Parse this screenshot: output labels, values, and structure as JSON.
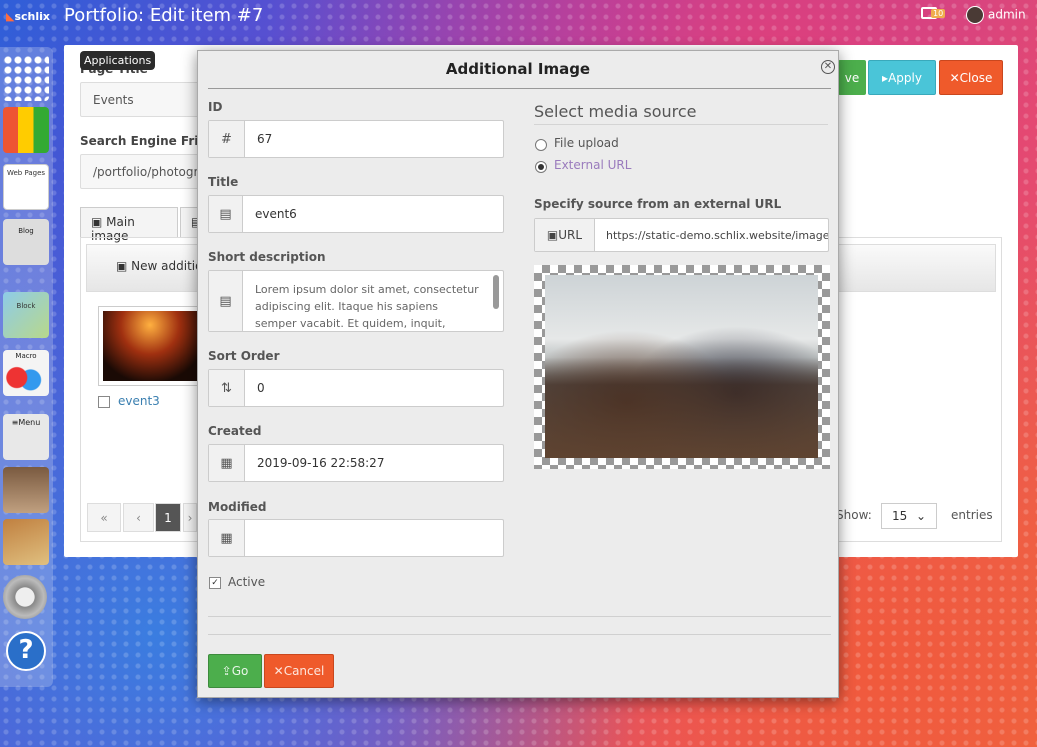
{
  "app": {
    "logo": "schlix",
    "title": "Portfolio: Edit item #7"
  },
  "header": {
    "notification_count": "10",
    "username": "admin"
  },
  "sidebar": {
    "tooltip": "Applications",
    "items": [
      {
        "name": "grid-icon",
        "label": ""
      },
      {
        "name": "applications-icon",
        "label": ""
      },
      {
        "name": "web-pages-icon",
        "label": "Web Pages"
      },
      {
        "name": "blog-icon",
        "label": "Blog"
      },
      {
        "name": "block-icon",
        "label": "Block"
      },
      {
        "name": "macro-icon",
        "label": "Macro"
      },
      {
        "name": "menu-icon",
        "label": "≡Menu"
      },
      {
        "name": "users-icon",
        "label": ""
      },
      {
        "name": "tools-icon",
        "label": ""
      },
      {
        "name": "gear-icon",
        "label": ""
      },
      {
        "name": "help-icon",
        "label": "?"
      }
    ]
  },
  "form": {
    "page_title_label": "Page Title",
    "page_title_value": "Events",
    "sef_label": "Search Engine Friend",
    "sef_value": "/portfolio/photogra",
    "tabs": [
      "Main image",
      ""
    ],
    "toolbar_new": "New additio",
    "save_label": "ve",
    "apply_label": "Apply",
    "close_label": "Close"
  },
  "gallery": {
    "items": [
      {
        "caption": "event3"
      }
    ],
    "pager": {
      "first": "«",
      "prev": "‹",
      "current": "1",
      "next": "›"
    },
    "show_label": "Show:",
    "show_value": "15",
    "entries_label": "entries"
  },
  "modal": {
    "title": "Additional Image",
    "fields": {
      "id": {
        "label": "ID",
        "value": "67",
        "icon": "#"
      },
      "title": {
        "label": "Title",
        "value": "event6"
      },
      "short_description": {
        "label": "Short description",
        "value": "Lorem ipsum dolor sit amet, consectetur adipiscing elit. Itaque his sapiens semper vacabit. Et quidem, inquit, vehementer"
      },
      "sort_order": {
        "label": "Sort Order",
        "value": "0"
      },
      "created": {
        "label": "Created",
        "value": "2019-09-16 22:58:27"
      },
      "modified": {
        "label": "Modified",
        "value": ""
      },
      "active": {
        "label": "Active",
        "checked": true
      }
    },
    "media": {
      "title": "Select media source",
      "options": [
        "File upload",
        "External URL"
      ],
      "selected": "External URL",
      "url_label": "Specify source from an external URL",
      "url_addon": "URL",
      "url_value": "https://static-demo.schlix.website/images"
    },
    "buttons": {
      "go": "Go",
      "cancel": "Cancel"
    }
  },
  "colors": {
    "success": "#4cae4c",
    "info": "#4ac5d8",
    "danger": "#ef5a2b",
    "link": "#3a7fb0",
    "selected_radio_text": "#9a7bbd"
  }
}
